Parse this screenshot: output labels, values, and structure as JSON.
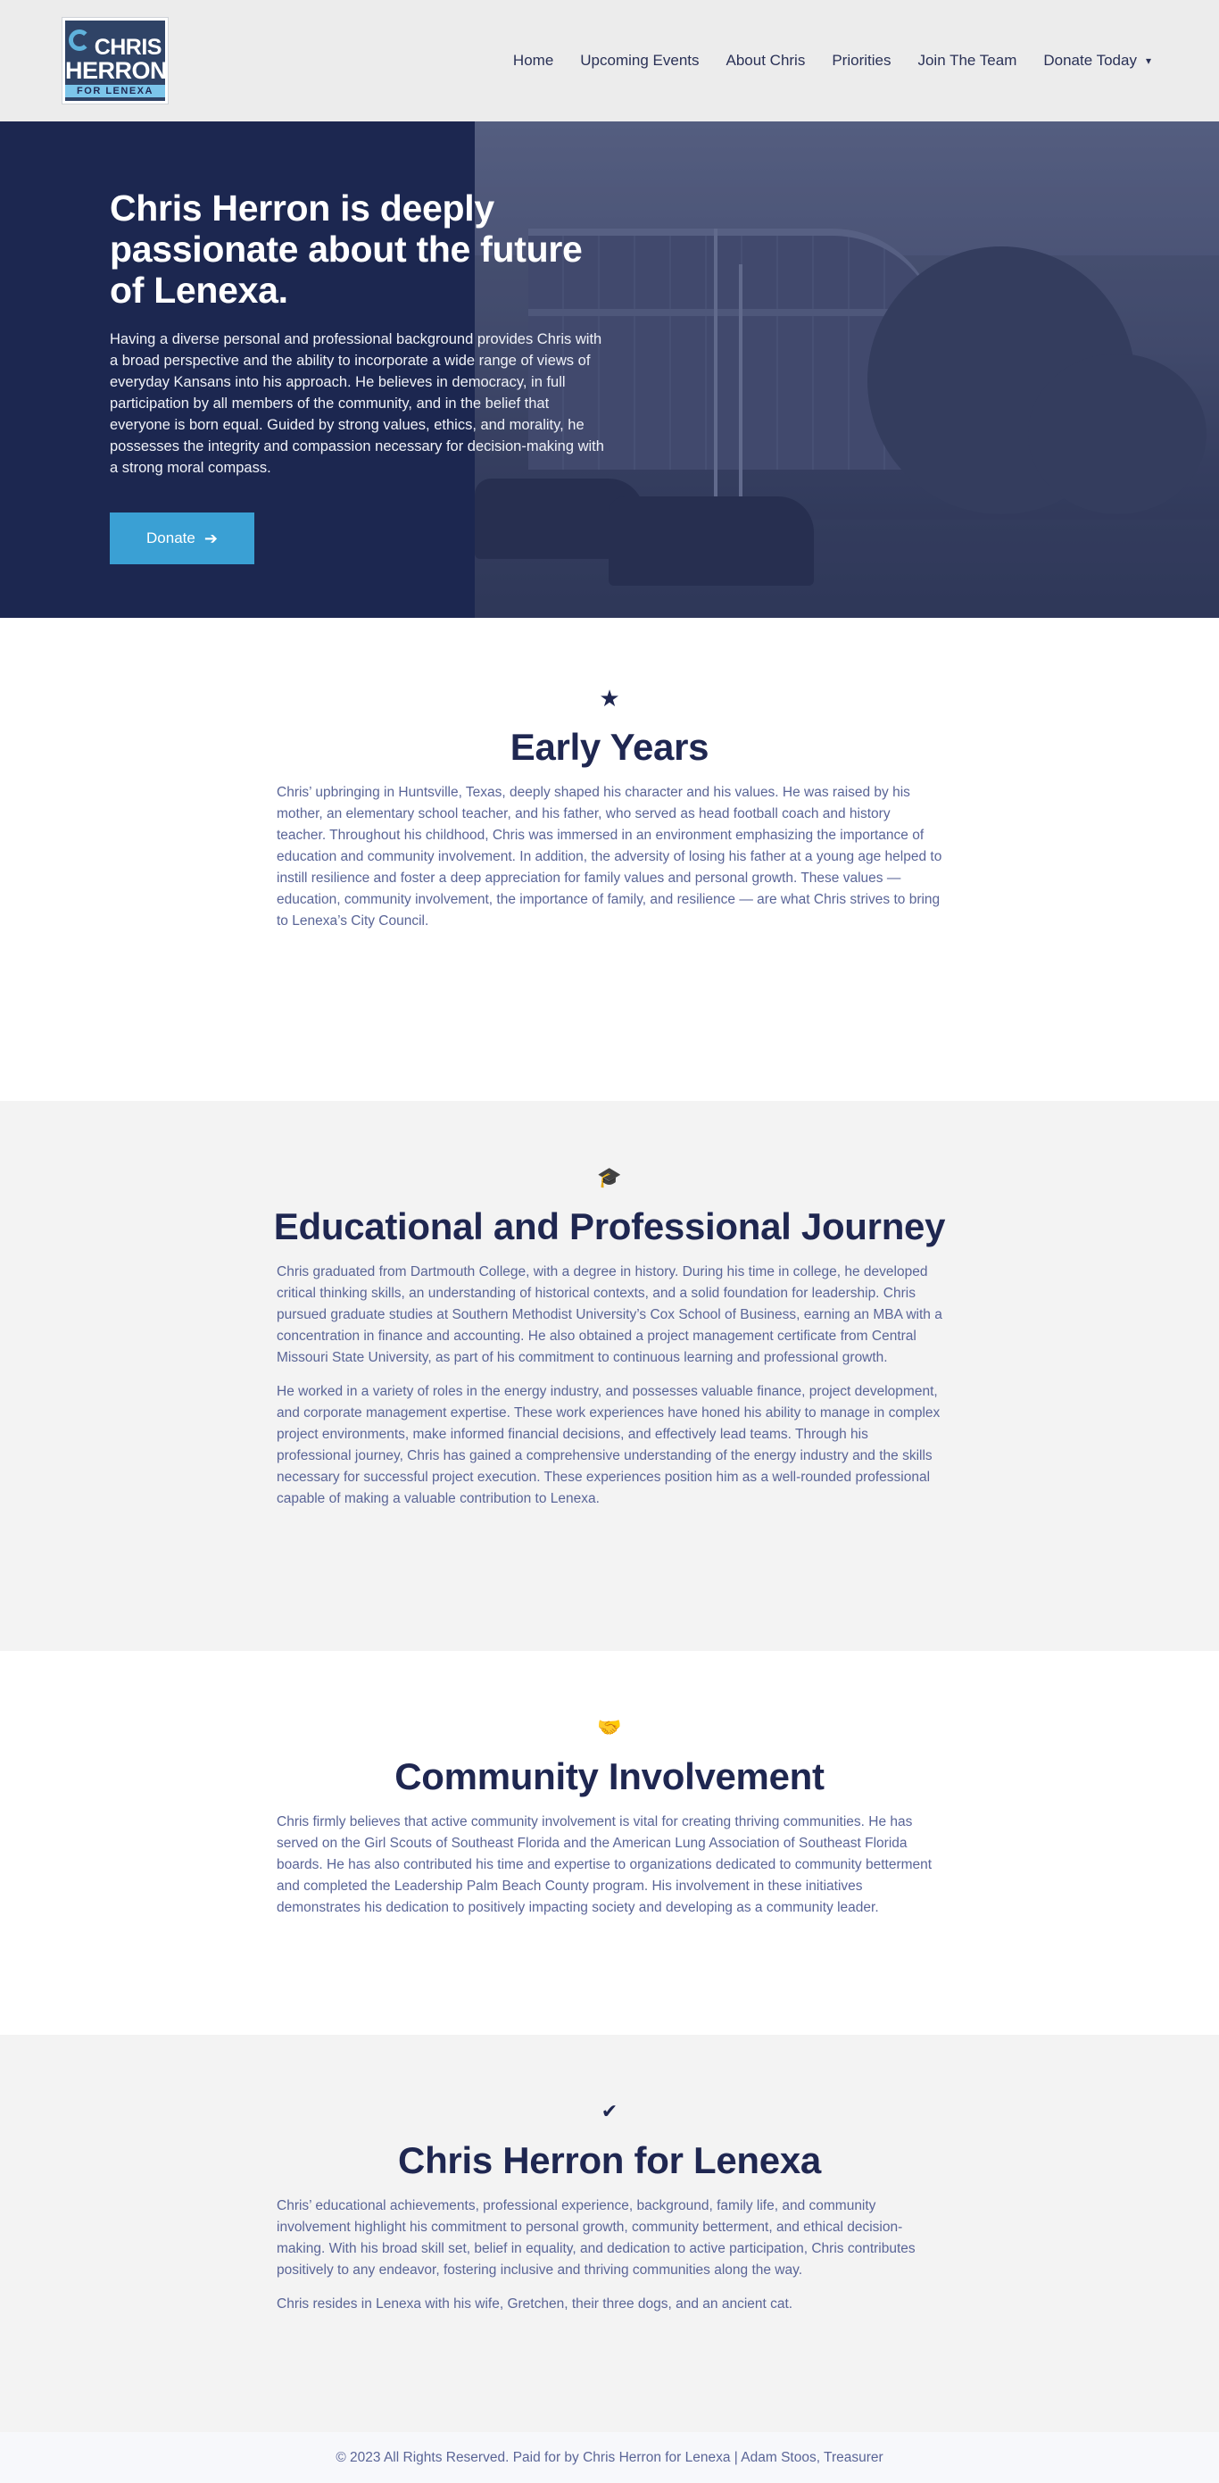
{
  "header": {
    "logo": {
      "line1": "CHRIS",
      "line2": "HERRON",
      "line3": "FOR LENEXA"
    },
    "nav": [
      {
        "label": "Home"
      },
      {
        "label": "Upcoming Events"
      },
      {
        "label": "About Chris"
      },
      {
        "label": "Priorities"
      },
      {
        "label": "Join The Team"
      },
      {
        "label": "Donate Today"
      }
    ],
    "nav_caret": "▾"
  },
  "hero": {
    "title": "Chris Herron is deeply passionate about the future of Lenexa.",
    "text": "Having a diverse personal and professional background provides Chris with a broad perspective and the ability to incorporate a wide range of views of everyday Kansans into his approach. He believes in democracy, in full participation by all members of the community, and in the belief that everyone is born equal. Guided by strong values, ethics, and morality, he possesses the integrity and compassion necessary for decision-making with a strong moral compass.",
    "button_label": "Donate",
    "button_icon": "arrow-right-icon",
    "button_color": "#3aa0d4",
    "background_color": "#1c2750"
  },
  "sections": [
    {
      "icon": "star-icon",
      "glyph": "★",
      "title": "Early Years",
      "paragraphs": [
        "Chris’ upbringing in Huntsville, Texas, deeply shaped his character and his values. He was raised by his mother, an elementary school teacher, and his father, who served as head football coach and history teacher. Throughout his childhood, Chris was immersed in an environment emphasizing the importance of education and community involvement. In addition, the adversity of losing his father at a young age helped to instill resilience and foster a deep appreciation for family values and personal growth. These values — education, community involvement, the importance of family, and resilience — are what Chris strives to bring to Lenexa’s City Council."
      ]
    },
    {
      "icon": "graduation-cap-icon",
      "glyph": "🎓",
      "title": "Educational and Professional Journey",
      "paragraphs": [
        "Chris graduated from Dartmouth College, with a degree in history. During his time in college, he developed critical thinking skills, an understanding of historical contexts, and a solid foundation for leadership. Chris pursued graduate studies at Southern Methodist University’s Cox School of Business, earning an MBA with a concentration in finance and accounting. He also obtained a project management certificate from Central Missouri State University, as part of his commitment to continuous learning and professional growth.",
        "He worked in a variety of roles in the energy industry, and possesses valuable finance, project development, and corporate management expertise. These work experiences have honed his ability to manage in complex project environments, make informed financial decisions, and effectively lead teams. Through his professional journey, Chris has gained a comprehensive understanding of the energy industry and the skills necessary for successful project execution. These experiences position him as a well-rounded professional capable of making a valuable contribution to Lenexa."
      ]
    },
    {
      "icon": "handshake-icon",
      "glyph": "🤝",
      "title": "Community Involvement",
      "paragraphs": [
        "Chris firmly believes that active community involvement is vital for creating thriving communities. He has served on the Girl Scouts of Southeast Florida and the American Lung Association of Southeast Florida boards. He has also contributed his time and expertise to organizations dedicated to community betterment and completed the Leadership Palm Beach County program. His involvement in these initiatives demonstrates his dedication to positively impacting society and developing as a community leader."
      ]
    },
    {
      "icon": "checkmark-icon",
      "glyph": "✔",
      "title": "Chris Herron for Lenexa",
      "paragraphs": [
        "Chris’ educational achievements, professional experience, background, family life, and community involvement highlight his commitment to personal growth, community betterment, and ethical decision-making. With his broad skill set, belief in equality, and dedication to active participation, Chris contributes positively to any endeavor, fostering inclusive and thriving communities along the way.",
        "Chris resides in Lenexa with his wife, Gretchen, their three dogs, and an ancient cat."
      ]
    }
  ],
  "footer": {
    "text": "© 2023 All Rights Reserved. Paid for by Chris Herron for Lenexa | Adam Stoos, Treasurer"
  }
}
